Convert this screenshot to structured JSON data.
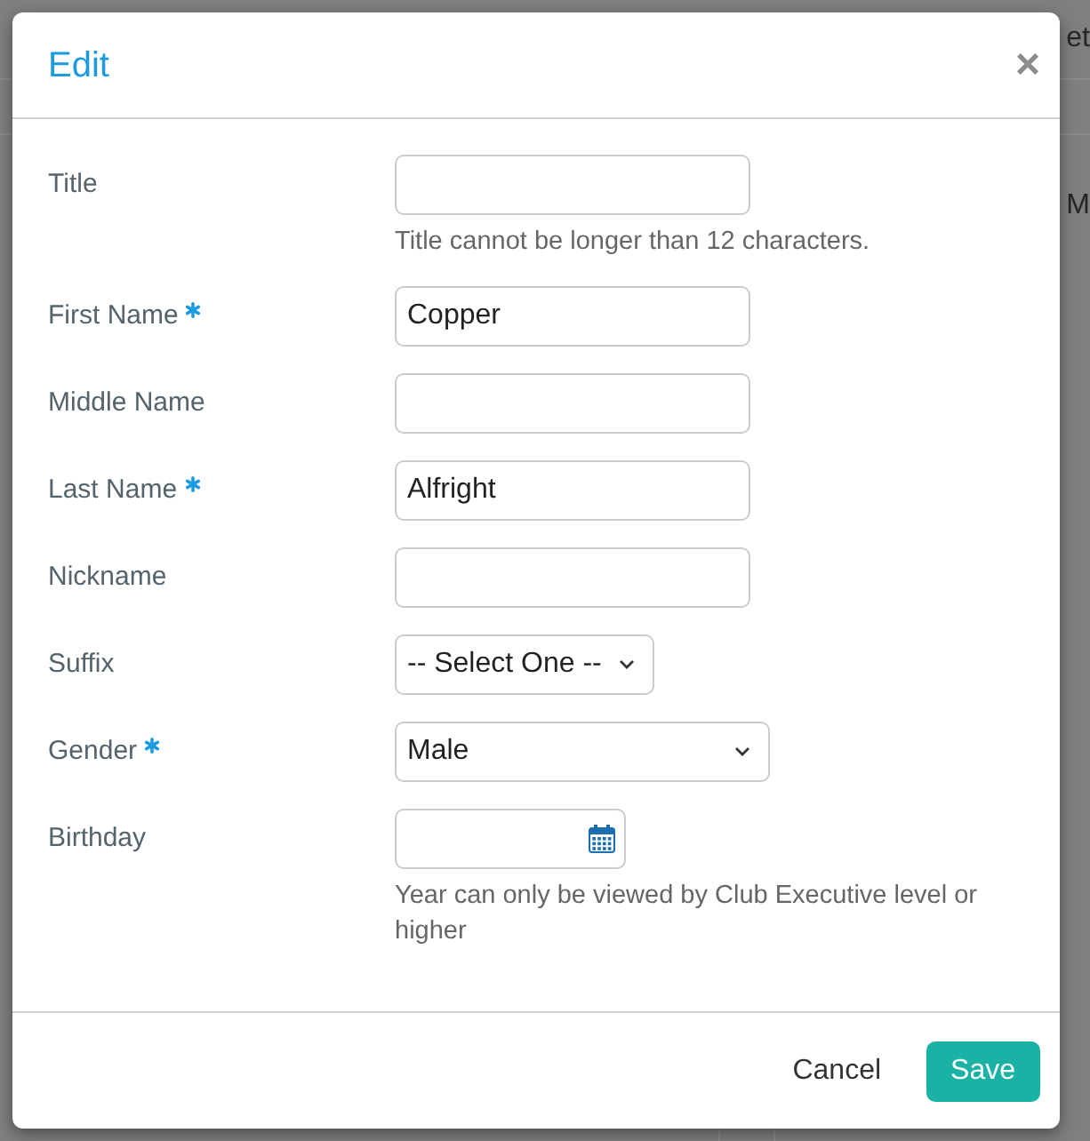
{
  "background_fragments": {
    "top_right": "et",
    "right_edge": "M"
  },
  "dialog": {
    "title": "Edit",
    "close": "×",
    "fields": [
      {
        "label": "Title",
        "required": false,
        "kind": "text",
        "hint": "Title cannot be longer than 12 characters."
      },
      {
        "label": "First Name",
        "required": true,
        "kind": "text",
        "value": "Copper"
      },
      {
        "label": "Middle Name",
        "required": false,
        "kind": "text"
      },
      {
        "label": "Last Name",
        "required": true,
        "kind": "text",
        "value": "Alfright"
      },
      {
        "label": "Nickname",
        "required": false,
        "kind": "text"
      },
      {
        "label": "Suffix",
        "required": false,
        "kind": "select",
        "value": "-- Select One --"
      },
      {
        "label": "Gender",
        "required": true,
        "kind": "dropdown",
        "value": "Male"
      },
      {
        "label": "Birthday",
        "required": false,
        "kind": "date",
        "hint": "Year can only be viewed by Club Executive level or higher"
      }
    ],
    "buttons": [
      {
        "label": "Cancel",
        "kind": "link"
      },
      {
        "label": "Save",
        "kind": "primary"
      }
    ]
  }
}
